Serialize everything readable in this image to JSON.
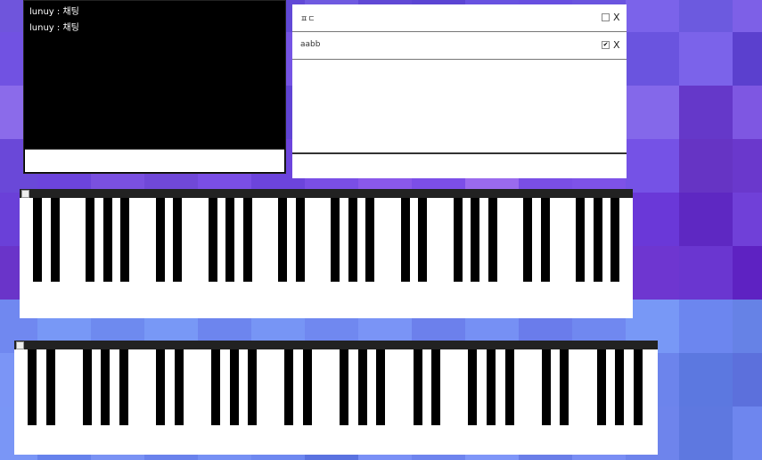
{
  "background": {
    "rows": [
      [
        "#6f55dc",
        "#5e48d6",
        "#6a52e0",
        "#6650dc",
        "#7258e3",
        "#6149d6",
        "#6f5ae0",
        "#6049d5",
        "#5b45d3",
        "#6852e0",
        "#684fe0",
        "#6a54df",
        "#7b63ea",
        "#6c5adf",
        "#7d60e7"
      ],
      [
        "#7152e2",
        "#6852e0",
        "#6a4fe0",
        "#7555e2",
        "#7a5ce6",
        "#7554e4",
        "#7e5ee8",
        "#8a6ae6",
        "#6f55e0",
        "#6b55df",
        "#6d55e0",
        "#6446da",
        "#6a54df",
        "#7b63ea",
        "#5b40ce"
      ],
      [
        "#8b6bea",
        "#7556e6",
        "#8a6ae6",
        "#6c4fdf",
        "#7d5bea",
        "#6044d4",
        "#8a6ae6",
        "#6a4fe0",
        "#714ee2",
        "#7852e6",
        "#7b55e6",
        "#845ee8",
        "#8468ea",
        "#6538c9",
        "#7e57e2"
      ],
      [
        "#6a48d8",
        "#6c44dc",
        "#7a50e0",
        "#7048d8",
        "#7a4ee6",
        "#6c44dc",
        "#7a4ee6",
        "#8a58ea",
        "#7c4ee8",
        "#9a6aee",
        "#7a4ee6",
        "#7e52e8",
        "#7552e6",
        "#6634c4",
        "#6a38cc"
      ],
      [
        "#6a40d8",
        "#7442d8",
        "#6a3ccf",
        "#7944dc",
        "#6a36d4",
        "#7a42da",
        "#6a32d0",
        "#7844de",
        "#6e34d2",
        "#6228c8",
        "#6a30cd",
        "#7a3ee0",
        "#6a38d8",
        "#5e28c2",
        "#7040d8"
      ],
      [
        "#6a34c9",
        "#6a3ecf",
        "#6a34d4",
        "#7442dc",
        "#6830d2",
        "#7a42d8",
        "#6a36c8",
        "#7840dc",
        "#6a30d0",
        "#6028c6",
        "#7236d6",
        "#6a30cc",
        "#6e36d0",
        "#6a36d0",
        "#5e22c2"
      ],
      [
        "#7088f0",
        "#7898f6",
        "#6e8aef",
        "#7898f6",
        "#6d85ee",
        "#7795f5",
        "#7088f0",
        "#7a94f6",
        "#6c80ec",
        "#7690f4",
        "#6a7ceb",
        "#7088f0",
        "#7898f6",
        "#6c86ef",
        "#6682e6"
      ],
      [
        "#7b95f6",
        "#6d84ee",
        "#5e6fe0",
        "#6a80ea",
        "#7088f0",
        "#6f86ef",
        "#7f96f8",
        "#6476e4",
        "#5f6ce0",
        "#7a8ff4",
        "#6a6ee6",
        "#7a5ae6",
        "#6c84ec",
        "#5c78e0",
        "#5c70dc"
      ],
      [
        "#7a96f6",
        "#6682ec",
        "#7a92f4",
        "#6a82ec",
        "#7690f4",
        "#6e88f0",
        "#5a72e0",
        "#7a90f6",
        "#6e84ee",
        "#7f96f8",
        "#6a7ee8",
        "#7a8ef4",
        "#6e84ec",
        "#5e78e0",
        "#6e86ee"
      ]
    ]
  },
  "chat": {
    "messages": [
      "lunuy : 채팅",
      "lunuy : 채팅"
    ],
    "input_value": ""
  },
  "todos": {
    "items": [
      {
        "text": "ㅍㄷ",
        "checked": false,
        "delete_label": "X"
      },
      {
        "text": "aabb",
        "checked": true,
        "delete_label": "X"
      }
    ],
    "input_value": ""
  },
  "pianos": [
    {
      "octaves": 5,
      "keys_per_octave_black": [
        1,
        1,
        0,
        1,
        1,
        1,
        0
      ]
    },
    {
      "octaves": 5,
      "keys_per_octave_black": [
        1,
        1,
        0,
        1,
        1,
        1,
        0
      ]
    }
  ]
}
